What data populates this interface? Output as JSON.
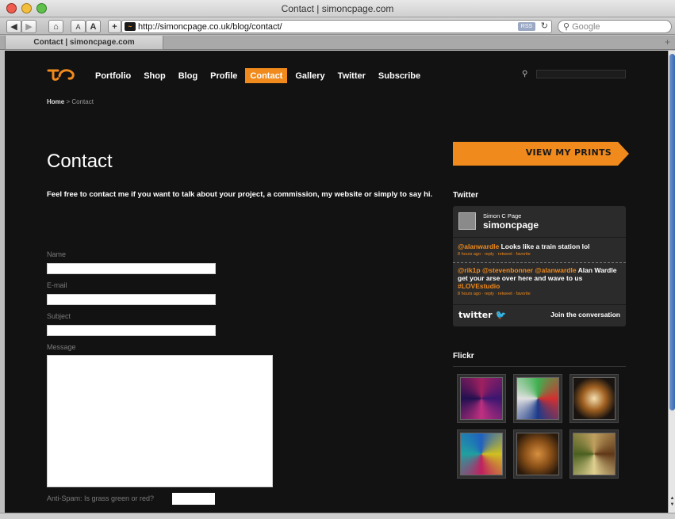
{
  "window": {
    "title": "Contact | simoncpage.com"
  },
  "toolbar": {
    "url": "http://simoncpage.co.uk/blog/contact/",
    "rss_label": "RSS",
    "search_placeholder": "Google",
    "text_small": "A",
    "text_large": "A",
    "add": "+"
  },
  "tab": {
    "label": "Contact | simoncpage.com"
  },
  "nav": {
    "items": [
      "Portfolio",
      "Shop",
      "Blog",
      "Profile",
      "Contact",
      "Gallery",
      "Twitter",
      "Subscribe"
    ],
    "active": "Contact"
  },
  "breadcrumb": {
    "home": "Home",
    "separator": " > ",
    "current": "Contact"
  },
  "main": {
    "title": "Contact",
    "intro": "Feel free to contact me if you want to talk about your project, a commission, my website or simply to say hi."
  },
  "form": {
    "name_label": "Name",
    "email_label": "E-mail",
    "subject_label": "Subject",
    "message_label": "Message",
    "antispam_label": "Anti-Spam: Is grass green or red?"
  },
  "sidebar": {
    "prints_button": "VIEW MY PRINTS",
    "twitter_heading": "Twitter",
    "twitter_name": "Simon C Page",
    "twitter_user": "simoncpage",
    "tweet1_mention": "@alanwardle",
    "tweet1_text": " Looks like a train station lol",
    "tweet1_meta": "8 hours ago · reply · retweet · favorite",
    "tweet2_m1": "@rik1p",
    "tweet2_m2": " @stevenbonner",
    "tweet2_m3": " @alanwardle",
    "tweet2_text": " Alan Wardle get your arse over here and wave to us ",
    "tweet2_tag": "#LOVEstudio",
    "tweet2_meta": "8 hours ago · reply · retweet · favorite",
    "twitter_logo": "twitter",
    "join_label": "Join the conversation",
    "flickr_heading": "Flickr"
  },
  "colors": {
    "accent": "#f08a1c",
    "background": "#121212"
  }
}
